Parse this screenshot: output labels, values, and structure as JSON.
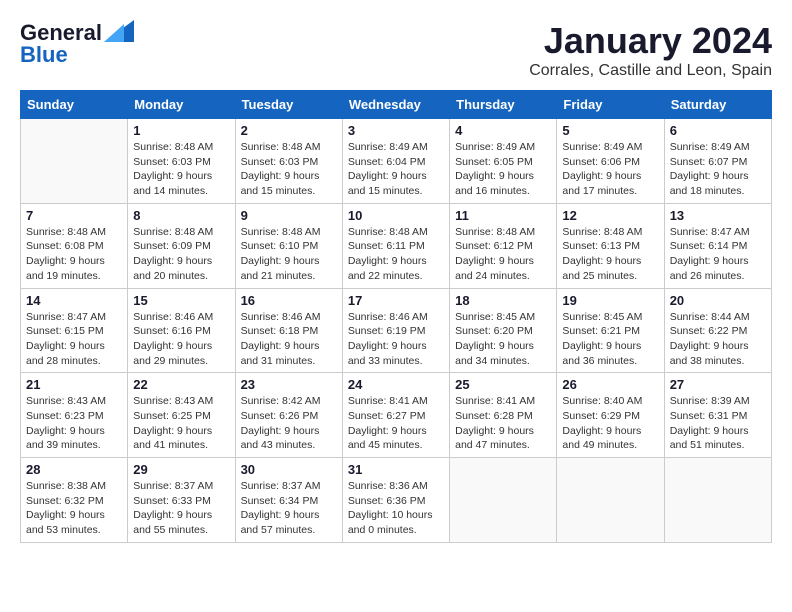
{
  "header": {
    "logo_general": "General",
    "logo_blue": "Blue",
    "month": "January 2024",
    "location": "Corrales, Castille and Leon, Spain"
  },
  "days_of_week": [
    "Sunday",
    "Monday",
    "Tuesday",
    "Wednesday",
    "Thursday",
    "Friday",
    "Saturday"
  ],
  "weeks": [
    [
      {
        "day": "",
        "sunrise": "",
        "sunset": "",
        "daylight": ""
      },
      {
        "day": "1",
        "sunrise": "Sunrise: 8:48 AM",
        "sunset": "Sunset: 6:03 PM",
        "daylight": "Daylight: 9 hours and 14 minutes."
      },
      {
        "day": "2",
        "sunrise": "Sunrise: 8:48 AM",
        "sunset": "Sunset: 6:03 PM",
        "daylight": "Daylight: 9 hours and 15 minutes."
      },
      {
        "day": "3",
        "sunrise": "Sunrise: 8:49 AM",
        "sunset": "Sunset: 6:04 PM",
        "daylight": "Daylight: 9 hours and 15 minutes."
      },
      {
        "day": "4",
        "sunrise": "Sunrise: 8:49 AM",
        "sunset": "Sunset: 6:05 PM",
        "daylight": "Daylight: 9 hours and 16 minutes."
      },
      {
        "day": "5",
        "sunrise": "Sunrise: 8:49 AM",
        "sunset": "Sunset: 6:06 PM",
        "daylight": "Daylight: 9 hours and 17 minutes."
      },
      {
        "day": "6",
        "sunrise": "Sunrise: 8:49 AM",
        "sunset": "Sunset: 6:07 PM",
        "daylight": "Daylight: 9 hours and 18 minutes."
      }
    ],
    [
      {
        "day": "7",
        "sunrise": "Sunrise: 8:48 AM",
        "sunset": "Sunset: 6:08 PM",
        "daylight": "Daylight: 9 hours and 19 minutes."
      },
      {
        "day": "8",
        "sunrise": "Sunrise: 8:48 AM",
        "sunset": "Sunset: 6:09 PM",
        "daylight": "Daylight: 9 hours and 20 minutes."
      },
      {
        "day": "9",
        "sunrise": "Sunrise: 8:48 AM",
        "sunset": "Sunset: 6:10 PM",
        "daylight": "Daylight: 9 hours and 21 minutes."
      },
      {
        "day": "10",
        "sunrise": "Sunrise: 8:48 AM",
        "sunset": "Sunset: 6:11 PM",
        "daylight": "Daylight: 9 hours and 22 minutes."
      },
      {
        "day": "11",
        "sunrise": "Sunrise: 8:48 AM",
        "sunset": "Sunset: 6:12 PM",
        "daylight": "Daylight: 9 hours and 24 minutes."
      },
      {
        "day": "12",
        "sunrise": "Sunrise: 8:48 AM",
        "sunset": "Sunset: 6:13 PM",
        "daylight": "Daylight: 9 hours and 25 minutes."
      },
      {
        "day": "13",
        "sunrise": "Sunrise: 8:47 AM",
        "sunset": "Sunset: 6:14 PM",
        "daylight": "Daylight: 9 hours and 26 minutes."
      }
    ],
    [
      {
        "day": "14",
        "sunrise": "Sunrise: 8:47 AM",
        "sunset": "Sunset: 6:15 PM",
        "daylight": "Daylight: 9 hours and 28 minutes."
      },
      {
        "day": "15",
        "sunrise": "Sunrise: 8:46 AM",
        "sunset": "Sunset: 6:16 PM",
        "daylight": "Daylight: 9 hours and 29 minutes."
      },
      {
        "day": "16",
        "sunrise": "Sunrise: 8:46 AM",
        "sunset": "Sunset: 6:18 PM",
        "daylight": "Daylight: 9 hours and 31 minutes."
      },
      {
        "day": "17",
        "sunrise": "Sunrise: 8:46 AM",
        "sunset": "Sunset: 6:19 PM",
        "daylight": "Daylight: 9 hours and 33 minutes."
      },
      {
        "day": "18",
        "sunrise": "Sunrise: 8:45 AM",
        "sunset": "Sunset: 6:20 PM",
        "daylight": "Daylight: 9 hours and 34 minutes."
      },
      {
        "day": "19",
        "sunrise": "Sunrise: 8:45 AM",
        "sunset": "Sunset: 6:21 PM",
        "daylight": "Daylight: 9 hours and 36 minutes."
      },
      {
        "day": "20",
        "sunrise": "Sunrise: 8:44 AM",
        "sunset": "Sunset: 6:22 PM",
        "daylight": "Daylight: 9 hours and 38 minutes."
      }
    ],
    [
      {
        "day": "21",
        "sunrise": "Sunrise: 8:43 AM",
        "sunset": "Sunset: 6:23 PM",
        "daylight": "Daylight: 9 hours and 39 minutes."
      },
      {
        "day": "22",
        "sunrise": "Sunrise: 8:43 AM",
        "sunset": "Sunset: 6:25 PM",
        "daylight": "Daylight: 9 hours and 41 minutes."
      },
      {
        "day": "23",
        "sunrise": "Sunrise: 8:42 AM",
        "sunset": "Sunset: 6:26 PM",
        "daylight": "Daylight: 9 hours and 43 minutes."
      },
      {
        "day": "24",
        "sunrise": "Sunrise: 8:41 AM",
        "sunset": "Sunset: 6:27 PM",
        "daylight": "Daylight: 9 hours and 45 minutes."
      },
      {
        "day": "25",
        "sunrise": "Sunrise: 8:41 AM",
        "sunset": "Sunset: 6:28 PM",
        "daylight": "Daylight: 9 hours and 47 minutes."
      },
      {
        "day": "26",
        "sunrise": "Sunrise: 8:40 AM",
        "sunset": "Sunset: 6:29 PM",
        "daylight": "Daylight: 9 hours and 49 minutes."
      },
      {
        "day": "27",
        "sunrise": "Sunrise: 8:39 AM",
        "sunset": "Sunset: 6:31 PM",
        "daylight": "Daylight: 9 hours and 51 minutes."
      }
    ],
    [
      {
        "day": "28",
        "sunrise": "Sunrise: 8:38 AM",
        "sunset": "Sunset: 6:32 PM",
        "daylight": "Daylight: 9 hours and 53 minutes."
      },
      {
        "day": "29",
        "sunrise": "Sunrise: 8:37 AM",
        "sunset": "Sunset: 6:33 PM",
        "daylight": "Daylight: 9 hours and 55 minutes."
      },
      {
        "day": "30",
        "sunrise": "Sunrise: 8:37 AM",
        "sunset": "Sunset: 6:34 PM",
        "daylight": "Daylight: 9 hours and 57 minutes."
      },
      {
        "day": "31",
        "sunrise": "Sunrise: 8:36 AM",
        "sunset": "Sunset: 6:36 PM",
        "daylight": "Daylight: 10 hours and 0 minutes."
      },
      {
        "day": "",
        "sunrise": "",
        "sunset": "",
        "daylight": ""
      },
      {
        "day": "",
        "sunrise": "",
        "sunset": "",
        "daylight": ""
      },
      {
        "day": "",
        "sunrise": "",
        "sunset": "",
        "daylight": ""
      }
    ]
  ]
}
